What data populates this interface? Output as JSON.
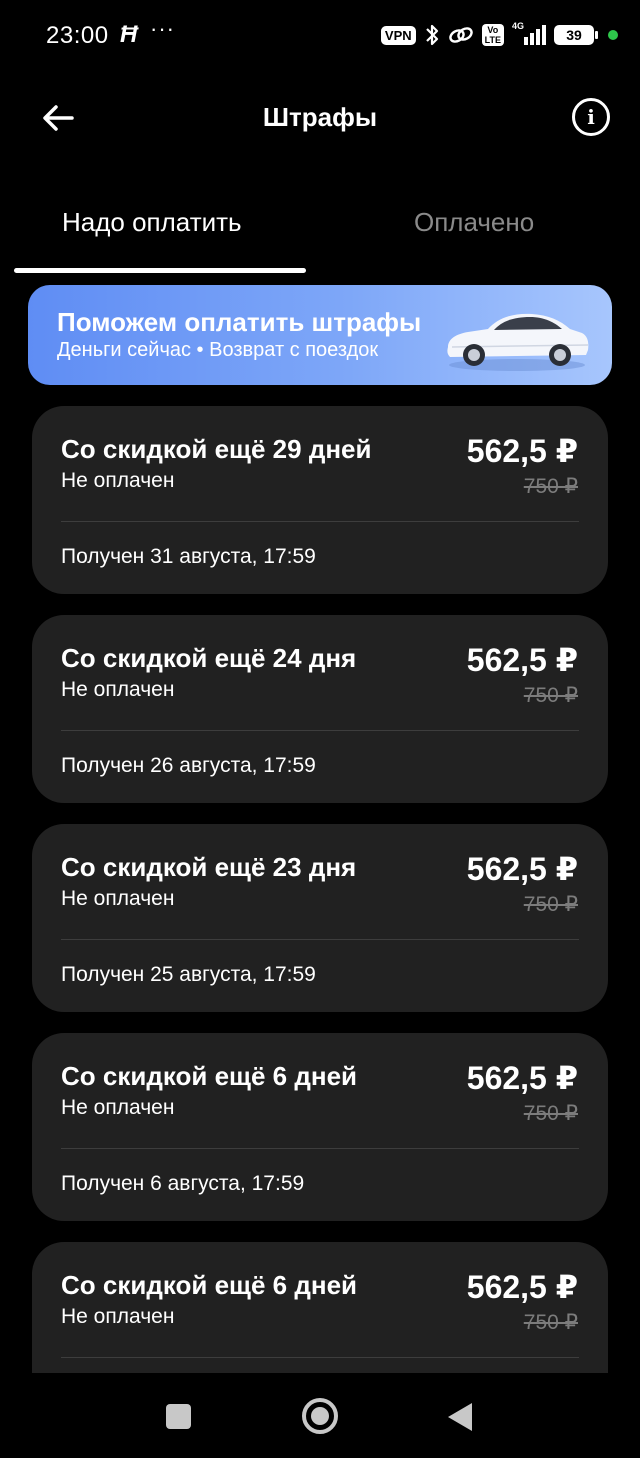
{
  "status_bar": {
    "time": "23:00",
    "app_icon": "hh",
    "dots": "···",
    "vpn": "VPN",
    "volte": "Vo\nLTE",
    "network": "4G",
    "battery": "39"
  },
  "header": {
    "title": "Штрафы"
  },
  "tabs": [
    {
      "label": "Надо оплатить",
      "active": true
    },
    {
      "label": "Оплачено",
      "active": false
    }
  ],
  "banner": {
    "title": "Поможем оплатить штрафы",
    "subtitle": "Деньги сейчас • Возврат с поездок"
  },
  "fines": [
    {
      "title": "Со скидкой ещё 29 дней",
      "status": "Не оплачен",
      "price": "562,5 ₽",
      "old_price": "750 ₽",
      "date": "Получен 31 августа, 17:59"
    },
    {
      "title": "Со скидкой ещё 24 дня",
      "status": "Не оплачен",
      "price": "562,5 ₽",
      "old_price": "750 ₽",
      "date": "Получен 26 августа, 17:59"
    },
    {
      "title": "Со скидкой ещё 23 дня",
      "status": "Не оплачен",
      "price": "562,5 ₽",
      "old_price": "750 ₽",
      "date": "Получен 25 августа, 17:59"
    },
    {
      "title": "Со скидкой ещё 6 дней",
      "status": "Не оплачен",
      "price": "562,5 ₽",
      "old_price": "750 ₽",
      "date": "Получен 6 августа, 17:59"
    },
    {
      "title": "Со скидкой ещё 6 дней",
      "status": "Не оплачен",
      "price": "562,5 ₽",
      "old_price": "750 ₽",
      "date": ""
    }
  ],
  "colors": {
    "background": "#000000",
    "card": "#212121",
    "banner_start": "#5f8df4",
    "banner_end": "#a7c6fd",
    "muted_text": "#8a8a8a"
  }
}
